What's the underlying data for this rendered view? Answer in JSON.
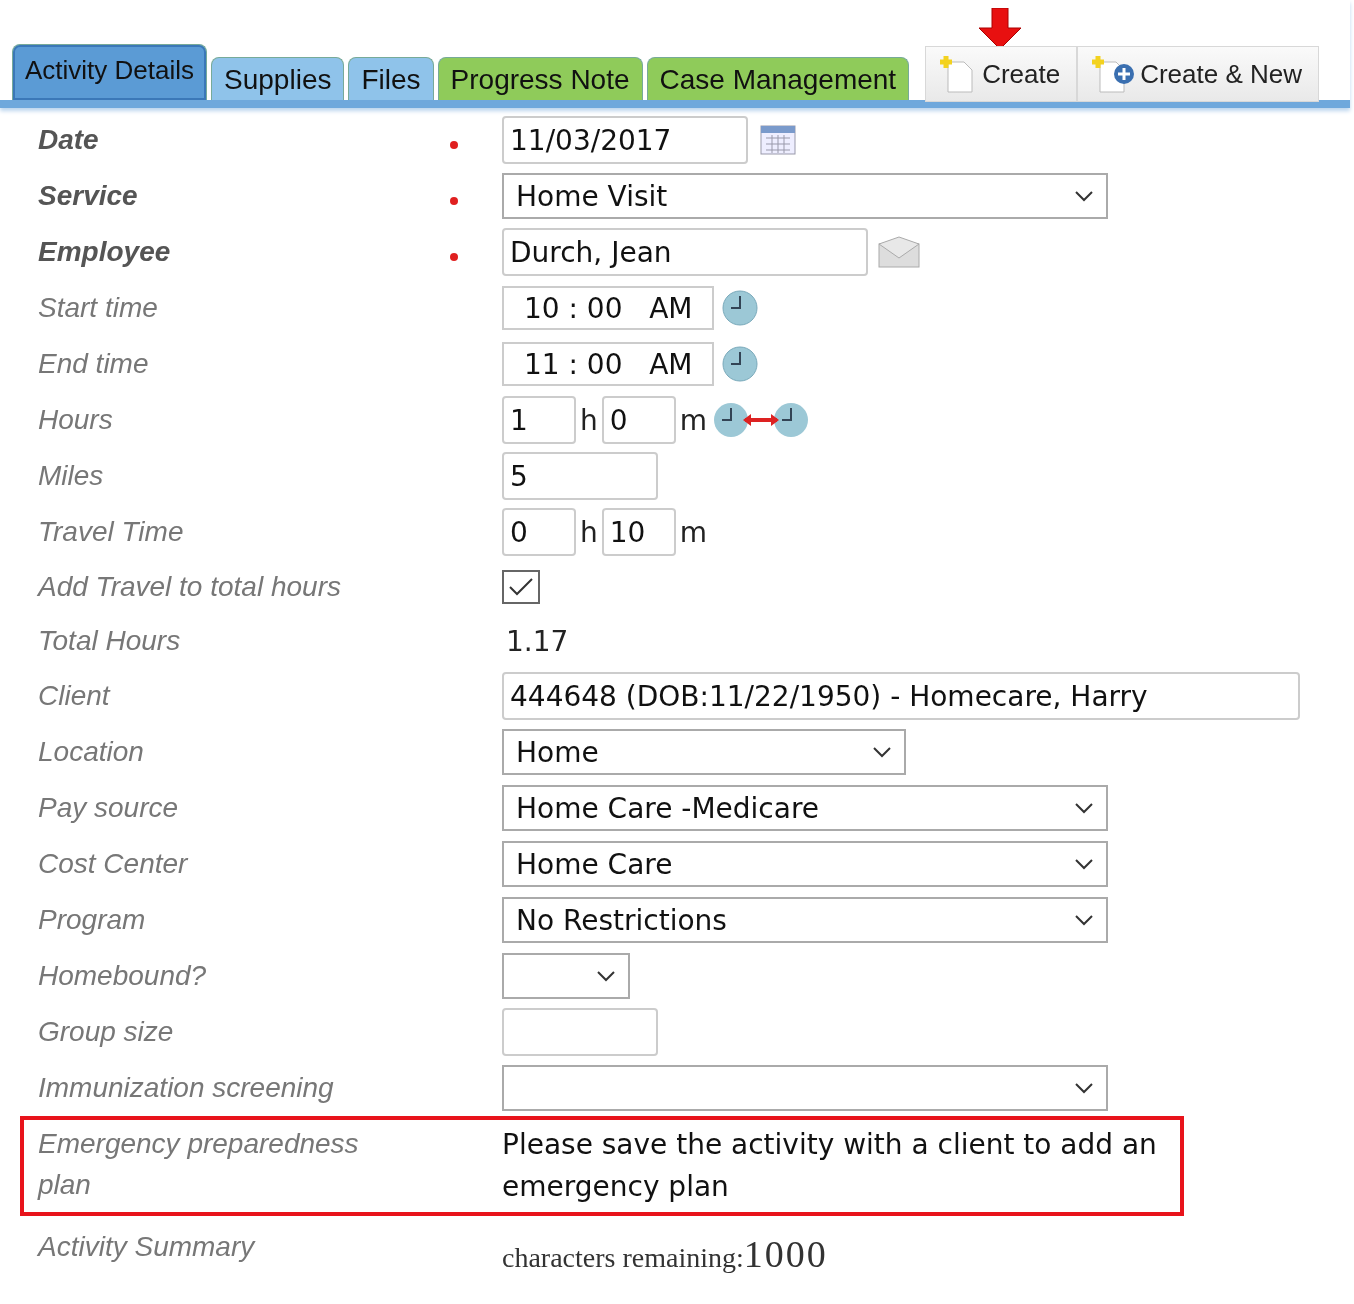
{
  "tabs": [
    {
      "label": "Activity Details",
      "selected": true,
      "color": "#5b9bd5"
    },
    {
      "label": "Supplies",
      "selected": false,
      "color": "#8fc3ea"
    },
    {
      "label": "Files",
      "selected": false,
      "color": "#8fc3ea"
    },
    {
      "label": "Progress Note",
      "selected": false,
      "color": "#8fcb5a"
    },
    {
      "label": "Case Management",
      "selected": false,
      "color": "#8fcb5a"
    }
  ],
  "actions": [
    {
      "label": "Create",
      "kind": "create",
      "pointed": true
    },
    {
      "label": "Create & New",
      "kind": "createnew"
    }
  ],
  "fields": [
    {
      "label": "Date",
      "required": true,
      "kind": "date",
      "value": "11/03/2017"
    },
    {
      "label": "Service",
      "required": true,
      "kind": "select",
      "value": "Home Visit"
    },
    {
      "label": "Employee",
      "required": true,
      "kind": "employee",
      "value": "Durch, Jean"
    },
    {
      "label": "Start time",
      "kind": "time",
      "value": "10 : 00   AM"
    },
    {
      "label": "End time",
      "kind": "time",
      "value": "11 : 00   AM"
    },
    {
      "label": "Hours",
      "kind": "hm",
      "hours": "1",
      "hours_unit": "h",
      "minutes": "0",
      "minutes_unit": "m",
      "calc": true
    },
    {
      "label": "Miles",
      "kind": "text",
      "value": "5"
    },
    {
      "label": "Travel Time",
      "kind": "hm",
      "hours": "0",
      "hours_unit": "h",
      "minutes": "10",
      "minutes_unit": "m"
    },
    {
      "label": "Add Travel to total hours",
      "kind": "checkbox",
      "checked": true
    },
    {
      "label": "Total Hours",
      "kind": "static",
      "value": "1.17"
    },
    {
      "label": "Client",
      "kind": "client",
      "value": "444648 (DOB:11/22/1950) - Homecare, Harry"
    },
    {
      "label": "Location",
      "kind": "select",
      "value": "Home"
    },
    {
      "label": "Pay source",
      "kind": "select",
      "value": "Home Care -Medicare"
    },
    {
      "label": "Cost Center",
      "kind": "select",
      "value": "Home Care"
    },
    {
      "label": "Program",
      "kind": "select",
      "value": "No Restrictions"
    },
    {
      "label": "Homebound?",
      "kind": "select"
    },
    {
      "label": "Group size",
      "kind": "text"
    },
    {
      "label": "Immunization screening",
      "kind": "select"
    },
    {
      "label": "Emergency preparedness plan",
      "kind": "message",
      "value": "Please save the activity with a client to add an emergency plan",
      "highlighted": true
    },
    {
      "label": "Activity Summary",
      "kind": "summary",
      "value": "characters remaining:",
      "count": "1000"
    }
  ]
}
